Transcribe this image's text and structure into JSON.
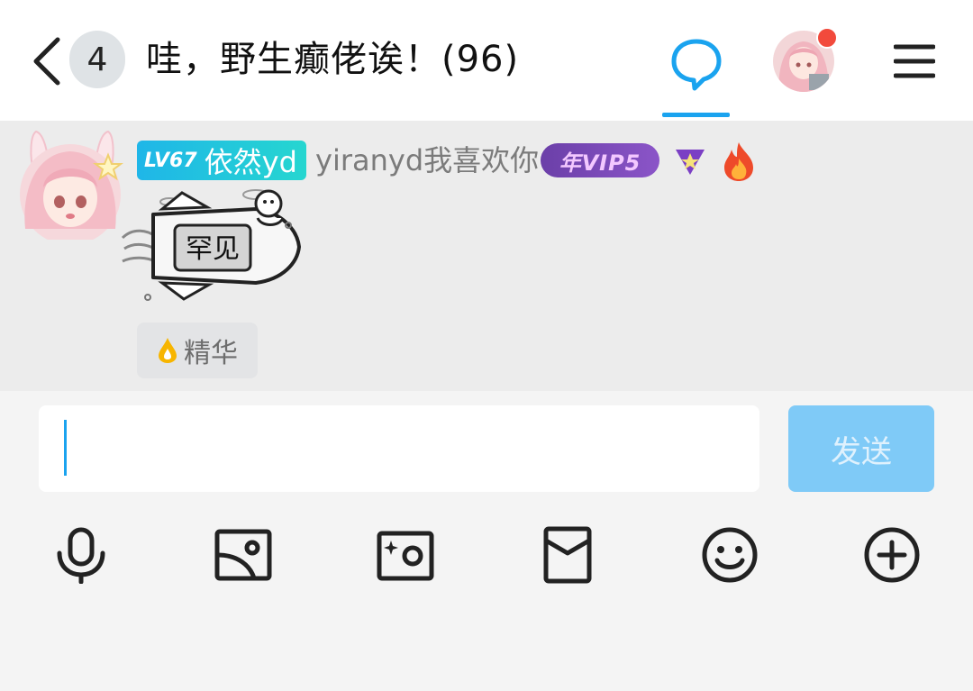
{
  "header": {
    "unread_count": "4",
    "title": "哇，野生癫佬诶！(96)",
    "icons": [
      "back-arrow-icon",
      "chat-bubble-icon",
      "avatar",
      "menu-icon"
    ],
    "accent_color": "#1aa3ef"
  },
  "message": {
    "level": "LV67",
    "group_nickname": "依然yd",
    "username": "yiranyd我喜欢你",
    "vip_label": "年VIP5",
    "sticker_text": "罕见",
    "essence_label": "精华"
  },
  "composer": {
    "input_value": "",
    "send_label": "发送",
    "tools": [
      "microphone-icon",
      "image-icon",
      "camera-icon",
      "red-packet-icon",
      "emoji-icon",
      "plus-icon"
    ]
  }
}
